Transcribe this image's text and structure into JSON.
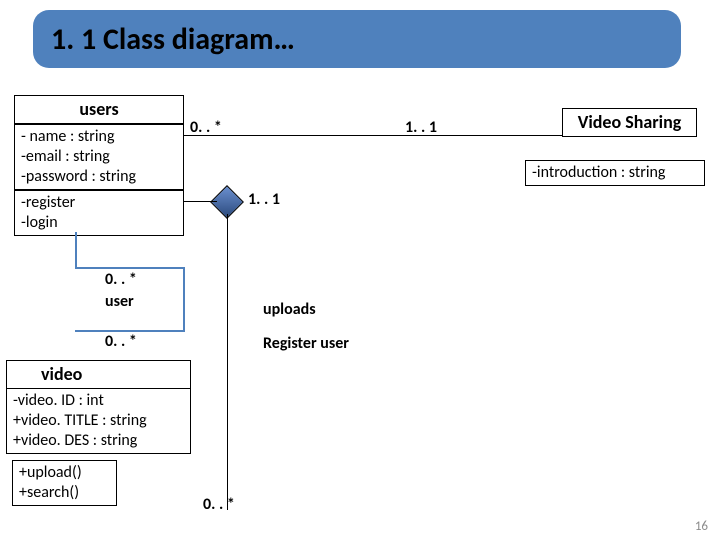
{
  "title": "1. 1 Class diagram…",
  "users": {
    "name": "users",
    "attrs": [
      "- name : string",
      "-email : string",
      "-password : string"
    ],
    "ops": [
      "-register",
      "-login"
    ]
  },
  "videoSharing": {
    "name": "Video Sharing",
    "attrs": [
      "-introduction : string"
    ]
  },
  "video": {
    "name": "video",
    "attrs": [
      "-video. ID : int",
      "+video. TITLE : string",
      "+video. DES : string"
    ],
    "ops": [
      "+upload()",
      "+search()"
    ]
  },
  "mult": {
    "users_vs_left": "0. . *",
    "users_vs_right": "1. . 1",
    "diamond_right": "1. . 1",
    "self_user_role": "user",
    "self_top": "0. . *",
    "self_bottom": "0. . *",
    "assoc_uploads": "uploads",
    "assoc_register": "Register user",
    "assoc_bottom": "0. . *"
  },
  "page_number": "16",
  "chart_data": {
    "type": "diagram",
    "diagram_kind": "UML class diagram",
    "classes": [
      {
        "name": "users",
        "attributes": [
          "- name : string",
          "-email : string",
          "-password : string"
        ],
        "operations": [
          "-register",
          "-login"
        ]
      },
      {
        "name": "Video Sharing",
        "attributes": [
          "-introduction : string"
        ],
        "operations": []
      },
      {
        "name": "video",
        "attributes": [
          "-video. ID : int",
          "+video. TITLE : string",
          "+video. DES : string"
        ],
        "operations": [
          "+upload()",
          "+search()"
        ]
      }
    ],
    "relationships": [
      {
        "from": "users",
        "to": "Video Sharing",
        "type": "association",
        "from_multiplicity": "0. . *",
        "to_multiplicity": "1. . 1"
      },
      {
        "from": "users",
        "to": "video",
        "type": "aggregation",
        "aggregate_end": "users",
        "from_multiplicity": "1. . 1",
        "to_multiplicity": "0. . *",
        "roles": [
          "uploads",
          "Register user"
        ]
      },
      {
        "from": "users",
        "to": "users",
        "type": "self-association",
        "role": "user",
        "multiplicities": [
          "0. . *",
          "0. . *"
        ]
      }
    ]
  }
}
